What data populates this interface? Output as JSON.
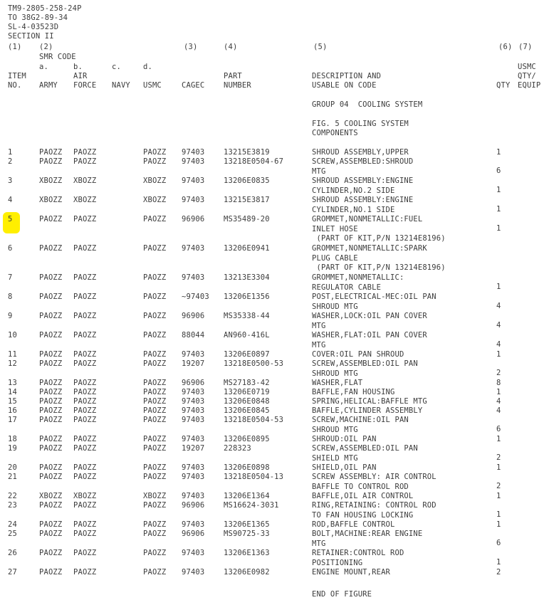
{
  "document": {
    "tm_number": "TM9-2805-258-24P",
    "to_number": "TO 38G2-89-34",
    "sl_number": "SL-4-03523D",
    "section": "SECTION II"
  },
  "column_numbers": {
    "n1": "(1)",
    "n2": "(2)",
    "n3": "(3)",
    "n4": "(4)",
    "n5": "(5)",
    "n6": "(6)",
    "n7": "(7)"
  },
  "headers": {
    "smr_code": "SMR CODE",
    "sub_a": "a.",
    "sub_b": "b.",
    "sub_c": "c.",
    "sub_d": "d.",
    "item_l1": "ITEM",
    "item_l2": "NO.",
    "army": "ARMY",
    "air_l1": "AIR",
    "air_l2": "FORCE",
    "navy": "NAVY",
    "usmc": "USMC",
    "cagec": "CAGEC",
    "part_l1": "PART",
    "part_l2": "NUMBER",
    "desc_l1": "DESCRIPTION AND",
    "desc_l2": "USABLE ON CODE",
    "qty": "QTY",
    "uqty_l1": "USMC",
    "uqty_l2": "QTY/",
    "uqty_l3": "EQUIP"
  },
  "group_title": "GROUP 04  COOLING SYSTEM",
  "figure_title_l1": "FIG. 5 COOLING SYSTEM",
  "figure_title_l2": "COMPONENTS",
  "end_of_figure": "END OF FIGURE",
  "highlight": {
    "item_no": "5",
    "color": "#ffef00"
  },
  "rows": [
    {
      "item": "1",
      "army": "PAOZZ",
      "air_force": "PAOZZ",
      "navy": "",
      "usmc": "PAOZZ",
      "cagec": "97403",
      "part_number": "13215E3819",
      "desc": [
        "SHROUD ASSEMBLY,UPPER"
      ],
      "qty": "1",
      "usmc_qty": ""
    },
    {
      "item": "2",
      "army": "PAOZZ",
      "air_force": "PAOZZ",
      "navy": "",
      "usmc": "PAOZZ",
      "cagec": "97403",
      "part_number": "13218E0504-67",
      "desc": [
        "SCREW,ASSEMBLED:SHROUD",
        "MTG"
      ],
      "qty": "6",
      "usmc_qty": ""
    },
    {
      "item": "3",
      "army": "XBOZZ",
      "air_force": "XBOZZ",
      "navy": "",
      "usmc": "XBOZZ",
      "cagec": "97403",
      "part_number": "13206E0835",
      "desc": [
        "SHROUD ASSEMBLY:ENGINE",
        "CYLINDER,NO.2 SIDE"
      ],
      "qty": "1",
      "usmc_qty": ""
    },
    {
      "item": "4",
      "army": "XBOZZ",
      "air_force": "XBOZZ",
      "navy": "",
      "usmc": "XBOZZ",
      "cagec": "97403",
      "part_number": "13215E3817",
      "desc": [
        "SHROUD ASSEMBLY:ENGINE",
        "CYLINDER,NO.1 SIDE"
      ],
      "qty": "1",
      "usmc_qty": ""
    },
    {
      "item": "5",
      "army": "PAOZZ",
      "air_force": "PAOZZ",
      "navy": "",
      "usmc": "PAOZZ",
      "cagec": "96906",
      "part_number": "MS35489-20",
      "desc": [
        "GROMMET,NONMETALLIC:FUEL",
        "INLET HOSE",
        " (PART OF KIT,P/N 13214E8196)"
      ],
      "qty": "1",
      "usmc_qty": ""
    },
    {
      "item": "6",
      "army": "PAOZZ",
      "air_force": "PAOZZ",
      "navy": "",
      "usmc": "PAOZZ",
      "cagec": "97403",
      "part_number": "13206E0941",
      "desc": [
        "GROMMET,NONMETALLIC:SPARK",
        "PLUG CABLE",
        " (PART OF KIT,P/N 13214E8196)"
      ],
      "qty": "",
      "usmc_qty": ""
    },
    {
      "item": "7",
      "army": "PAOZZ",
      "air_force": "PAOZZ",
      "navy": "",
      "usmc": "PAOZZ",
      "cagec": "97403",
      "part_number": "13213E3304",
      "desc": [
        "GROMMET,NONMETALLIC:",
        "REGULATOR CABLE"
      ],
      "qty": "1",
      "usmc_qty": ""
    },
    {
      "item": "8",
      "army": "PAOZZ",
      "air_force": "PAOZZ",
      "navy": "",
      "usmc": "PAOZZ",
      "cagec": "~97403",
      "part_number": "13206E1356",
      "desc": [
        "POST,ELECTRICAL-MEC:OIL PAN",
        "SHROUD MTG"
      ],
      "qty": "4",
      "usmc_qty": ""
    },
    {
      "item": "9",
      "army": "PAOZZ",
      "air_force": "PAOZZ",
      "navy": "",
      "usmc": "PAOZZ",
      "cagec": "96906",
      "part_number": "MS35338-44",
      "desc": [
        "WASHER,LOCK:OIL PAN COVER",
        "MTG"
      ],
      "qty": "4",
      "usmc_qty": ""
    },
    {
      "item": "10",
      "army": "PAOZZ",
      "air_force": "PAOZZ",
      "navy": "",
      "usmc": "PAOZZ",
      "cagec": "88044",
      "part_number": "AN960-416L",
      "desc": [
        "WASHER,FLAT:OIL PAN COVER",
        "MTG"
      ],
      "qty": "4",
      "usmc_qty": ""
    },
    {
      "item": "11",
      "army": "PAOZZ",
      "air_force": "PAOZZ",
      "navy": "",
      "usmc": "PAOZZ",
      "cagec": "97403",
      "part_number": "13206E0897",
      "desc": [
        "COVER:OIL PAN SHROUD"
      ],
      "qty": "1",
      "usmc_qty": ""
    },
    {
      "item": "12",
      "army": "PAOZZ",
      "air_force": "PAOZZ",
      "navy": "",
      "usmc": "PAOZZ",
      "cagec": "19207",
      "part_number": "13218E0500-53",
      "desc": [
        "SCREW,ASSEMBLED:OIL PAN",
        "SHROUD MTG"
      ],
      "qty": "2",
      "usmc_qty": ""
    },
    {
      "item": "13",
      "army": "PAOZZ",
      "air_force": "PAOZZ",
      "navy": "",
      "usmc": "PAOZZ",
      "cagec": "96906",
      "part_number": "MS27183-42",
      "desc": [
        "WASHER,FLAT"
      ],
      "qty": "8",
      "usmc_qty": ""
    },
    {
      "item": "14",
      "army": "PAOZZ",
      "air_force": "PAOZZ",
      "navy": "",
      "usmc": "PAOZZ",
      "cagec": "97403",
      "part_number": "13206E0719",
      "desc": [
        "BAFFLE,FAN HOUSING"
      ],
      "qty": "1",
      "usmc_qty": ""
    },
    {
      "item": "15",
      "army": "PAOZZ",
      "air_force": "PAOZZ",
      "navy": "",
      "usmc": "PAOZZ",
      "cagec": "97403",
      "part_number": "13206E0848",
      "desc": [
        "SPRING,HELICAL:BAFFLE MTG"
      ],
      "qty": "4",
      "usmc_qty": ""
    },
    {
      "item": "16",
      "army": "PAOZZ",
      "air_force": "PAOZZ",
      "navy": "",
      "usmc": "PAOZZ",
      "cagec": "97403",
      "part_number": "13206E0845",
      "desc": [
        "BAFFLE,CYLINDER ASSEMBLY"
      ],
      "qty": "4",
      "usmc_qty": ""
    },
    {
      "item": "17",
      "army": "PAOZZ",
      "air_force": "PAOZZ",
      "navy": "",
      "usmc": "PAOZZ",
      "cagec": "97403",
      "part_number": "13218E0504-53",
      "desc": [
        "SCREW,MACHINE:OIL PAN",
        "SHROUD MTG"
      ],
      "qty": "6",
      "usmc_qty": ""
    },
    {
      "item": "18",
      "army": "PAOZZ",
      "air_force": "PAOZZ",
      "navy": "",
      "usmc": "PAOZZ",
      "cagec": "97403",
      "part_number": "13206E0895",
      "desc": [
        "SHROUD:OIL PAN"
      ],
      "qty": "1",
      "usmc_qty": ""
    },
    {
      "item": "19",
      "army": "PAOZZ",
      "air_force": "PAOZZ",
      "navy": "",
      "usmc": "PAOZZ",
      "cagec": "19207",
      "part_number": "228323",
      "desc": [
        "SCREW,ASSEMBLED:OIL PAN",
        "SHIELD MTG"
      ],
      "qty": "2",
      "usmc_qty": ""
    },
    {
      "item": "20",
      "army": "PAOZZ",
      "air_force": "PAOZZ",
      "navy": "",
      "usmc": "PAOZZ",
      "cagec": "97403",
      "part_number": "13206E0898",
      "desc": [
        "SHIELD,OIL PAN"
      ],
      "qty": "1",
      "usmc_qty": ""
    },
    {
      "item": "21",
      "army": "PAOZZ",
      "air_force": "PAOZZ",
      "navy": "",
      "usmc": "PAOZZ",
      "cagec": "97403",
      "part_number": "13218E0504-13",
      "desc": [
        "SCREW ASSEMBLY: AIR CONTROL",
        "BAFFLE TO CONTROL ROD"
      ],
      "qty": "2",
      "usmc_qty": ""
    },
    {
      "item": "22",
      "army": "XBOZZ",
      "air_force": "XBOZZ",
      "navy": "",
      "usmc": "XBOZZ",
      "cagec": "97403",
      "part_number": "13206E1364",
      "desc": [
        "BAFFLE,OIL AIR CONTROL"
      ],
      "qty": "1",
      "usmc_qty": ""
    },
    {
      "item": "23",
      "army": "PAOZZ",
      "air_force": "PAOZZ",
      "navy": "",
      "usmc": "PAOZZ",
      "cagec": "96906",
      "part_number": "MS16624-3031",
      "desc": [
        "RING,RETAINING: CONTROL ROD",
        "TO FAN HOUSING LOCKING"
      ],
      "qty": "1",
      "usmc_qty": ""
    },
    {
      "item": "24",
      "army": "PAOZZ",
      "air_force": "PAOZZ",
      "navy": "",
      "usmc": "PAOZZ",
      "cagec": "97403",
      "part_number": "13206E1365",
      "desc": [
        "ROD,BAFFLE CONTROL"
      ],
      "qty": "1",
      "usmc_qty": ""
    },
    {
      "item": "25",
      "army": "PAOZZ",
      "air_force": "PAOZZ",
      "navy": "",
      "usmc": "PAOZZ",
      "cagec": "96906",
      "part_number": "MS90725-33",
      "desc": [
        "BOLT,MACHINE:REAR ENGINE",
        "MTG"
      ],
      "qty": "6",
      "usmc_qty": ""
    },
    {
      "item": "26",
      "army": "PAOZZ",
      "air_force": "PAOZZ",
      "navy": "",
      "usmc": "PAOZZ",
      "cagec": "97403",
      "part_number": "13206E1363",
      "desc": [
        "RETAINER:CONTROL ROD",
        "POSITIONING"
      ],
      "qty": "1",
      "usmc_qty": ""
    },
    {
      "item": "27",
      "army": "PAOZZ",
      "air_force": "PAOZZ",
      "navy": "",
      "usmc": "PAOZZ",
      "cagec": "97403",
      "part_number": "13206E0982",
      "desc": [
        "ENGINE MOUNT,REAR"
      ],
      "qty": "2",
      "usmc_qty": ""
    }
  ],
  "layout": {
    "line_height": 13.5,
    "row_tops": [
      208,
      221,
      248,
      275,
      302,
      343,
      384,
      411,
      438,
      465,
      492,
      505,
      532,
      545,
      558,
      571,
      584,
      611,
      624,
      651,
      664,
      691,
      704,
      731,
      744,
      771,
      798
    ],
    "desc_tops": [
      208,
      221,
      248,
      275,
      302,
      343,
      384,
      411,
      438,
      465,
      492,
      505,
      532,
      545,
      558,
      571,
      584,
      611,
      624,
      651,
      664,
      691,
      704,
      731,
      744,
      771,
      798
    ],
    "qty_tops": [
      208,
      234,
      261,
      288,
      315,
      0,
      397,
      424,
      451,
      478,
      492,
      518,
      532,
      545,
      558,
      571,
      597,
      611,
      637,
      651,
      677,
      691,
      717,
      731,
      757,
      784,
      798
    ]
  }
}
